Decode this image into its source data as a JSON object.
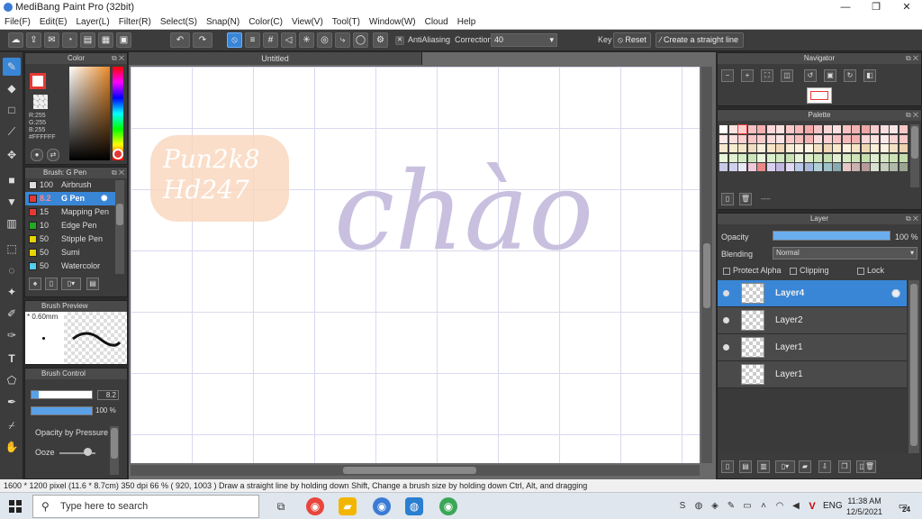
{
  "window": {
    "title": "MediBang Paint Pro (32bit)",
    "minimize": "—",
    "maximize": "❐",
    "close": "✕"
  },
  "menu": [
    "File(F)",
    "Edit(E)",
    "Layer(L)",
    "Filter(R)",
    "Select(S)",
    "Snap(N)",
    "Color(C)",
    "View(V)",
    "Tool(T)",
    "Window(W)",
    "Cloud",
    "Help"
  ],
  "toolbar": {
    "antialias_label": "AntiAliasing",
    "correction_label": "Correction",
    "correction_value": "40",
    "key_label": "Key",
    "reset_label": "Reset",
    "straight_line_label": "Create a straight line"
  },
  "color_panel": {
    "title": "Color",
    "r": "R:255",
    "g": "G:255",
    "b": "B:255",
    "hex": "#FFFFFF"
  },
  "brush_panel": {
    "title": "Brush: G Pen",
    "items": [
      {
        "size": "100",
        "name": "Airbrush",
        "color": "#dddddd"
      },
      {
        "size": "8.2",
        "name": "G Pen",
        "color": "#e53935"
      },
      {
        "size": "15",
        "name": "Mapping Pen",
        "color": "#e53935"
      },
      {
        "size": "10",
        "name": "Edge Pen",
        "color": "#22aa22"
      },
      {
        "size": "50",
        "name": "Stipple Pen",
        "color": "#e8d400"
      },
      {
        "size": "50",
        "name": "Sumi",
        "color": "#e8d400"
      },
      {
        "size": "50",
        "name": "Watercolor",
        "color": "#55ccee"
      }
    ]
  },
  "brush_preview": {
    "title": "Brush Preview",
    "size": "0.60mm"
  },
  "brush_control": {
    "title": "Brush Control",
    "size_value": "8.2",
    "opacity_value": "100 %",
    "opacity_pressure": "Opacity by Pressure",
    "ooze": "Ooze"
  },
  "canvas": {
    "tab": "Untitled",
    "watermark_line1": "Pun2k8",
    "watermark_line2": "Hd247",
    "lettering": "chào"
  },
  "navigator": {
    "title": "Navigator"
  },
  "palette": {
    "title": "Palette",
    "name": "----",
    "colors": [
      "#ffffff",
      "#fde2e2",
      "#fbd0d0",
      "#f8c0c0",
      "#f6b0b0",
      "#fcd8d8",
      "#fbe0e0",
      "#fac8c8",
      "#f8b8b8",
      "#f4a8a8",
      "#f6c6c6",
      "#f9d6d6",
      "#fae0e0",
      "#f7c2c2",
      "#f3b2b2",
      "#f0a6a6",
      "#f7cdcd",
      "#f9dede",
      "#fbe6e6",
      "#f6c8c8",
      "#fde8e8",
      "#fbdede",
      "#fad0d0",
      "#f8c4c4",
      "#f9cccc",
      "#fadada",
      "#fbe3e3",
      "#f7c9c9",
      "#f6bebe",
      "#f4b4b4",
      "#fcdcdc",
      "#f9cfcf",
      "#f7c3c3",
      "#f5baba",
      "#f3b0b0",
      "#fad6d6",
      "#fbe0e0",
      "#fde9e9",
      "#f9d2d2",
      "#f8c8c8",
      "#f6e8d0",
      "#f8eccf",
      "#f5e6c8",
      "#f0dcc0",
      "#fbeeda",
      "#f8e4c8",
      "#f2d8b8",
      "#f9ecd4",
      "#fbf0dc",
      "#fdf4e4",
      "#f4e0c4",
      "#f1d6b6",
      "#f8e8cc",
      "#fcf2de",
      "#f6e4c6",
      "#f0d8b4",
      "#f9eed6",
      "#fbf2e0",
      "#f5e2c4",
      "#eed2ae",
      "#e6f4d8",
      "#e0f0d0",
      "#d6ecc6",
      "#cce6bc",
      "#e8f6dc",
      "#dcefcc",
      "#d2e8c0",
      "#c8e2b4",
      "#e4f2d6",
      "#daecc8",
      "#d0e6bc",
      "#c6e0b0",
      "#e2f0d2",
      "#d8eac4",
      "#cee4b8",
      "#c4deac",
      "#e0eed0",
      "#d6e8c2",
      "#cce2b6",
      "#c2dcaa",
      "#c8c8e8",
      "#d0d0ee",
      "#e8e8f8",
      "#f0c8d8",
      "#e88888",
      "#d8d0f0",
      "#c0b8e0",
      "#e0d8f4",
      "#b8c8e8",
      "#a8b8d8",
      "#b0d0d8",
      "#9cc0c8",
      "#88aab0",
      "#e4c8c8",
      "#ccb0b0",
      "#b89898",
      "#d8e0d0",
      "#c4ccbc",
      "#b0b8a8",
      "#9ca494"
    ]
  },
  "layer_panel": {
    "title": "Layer",
    "opacity_label": "Opacity",
    "opacity_value": "100 %",
    "opacity_fraction": 1.0,
    "blending_label": "Blending",
    "blending_value": "Normal",
    "protect_alpha": "Protect Alpha",
    "clipping": "Clipping",
    "lock": "Lock",
    "layers": [
      {
        "name": "Layer4",
        "selected": true,
        "visible": true
      },
      {
        "name": "Layer2",
        "selected": false,
        "visible": true
      },
      {
        "name": "Layer1",
        "selected": false,
        "visible": true
      },
      {
        "name": "Layer1",
        "selected": false,
        "visible": false
      }
    ]
  },
  "status": {
    "text": "1600 * 1200 pixel   (11.6 * 8.7cm)   350 dpi   66 %   ( 920, 1003 )   Draw a straight line by holding down Shift, Change a brush size by holding down Ctrl, Alt, and dragging"
  },
  "taskbar": {
    "search_placeholder": "Type here to search",
    "language": "ENG",
    "time": "11:38 AM",
    "date": "12/5/2021",
    "notifications": "24"
  },
  "colors": {
    "accent": "#3a86d6",
    "lettering": "#c9c0e0",
    "watermark": "#f7c9a8"
  }
}
